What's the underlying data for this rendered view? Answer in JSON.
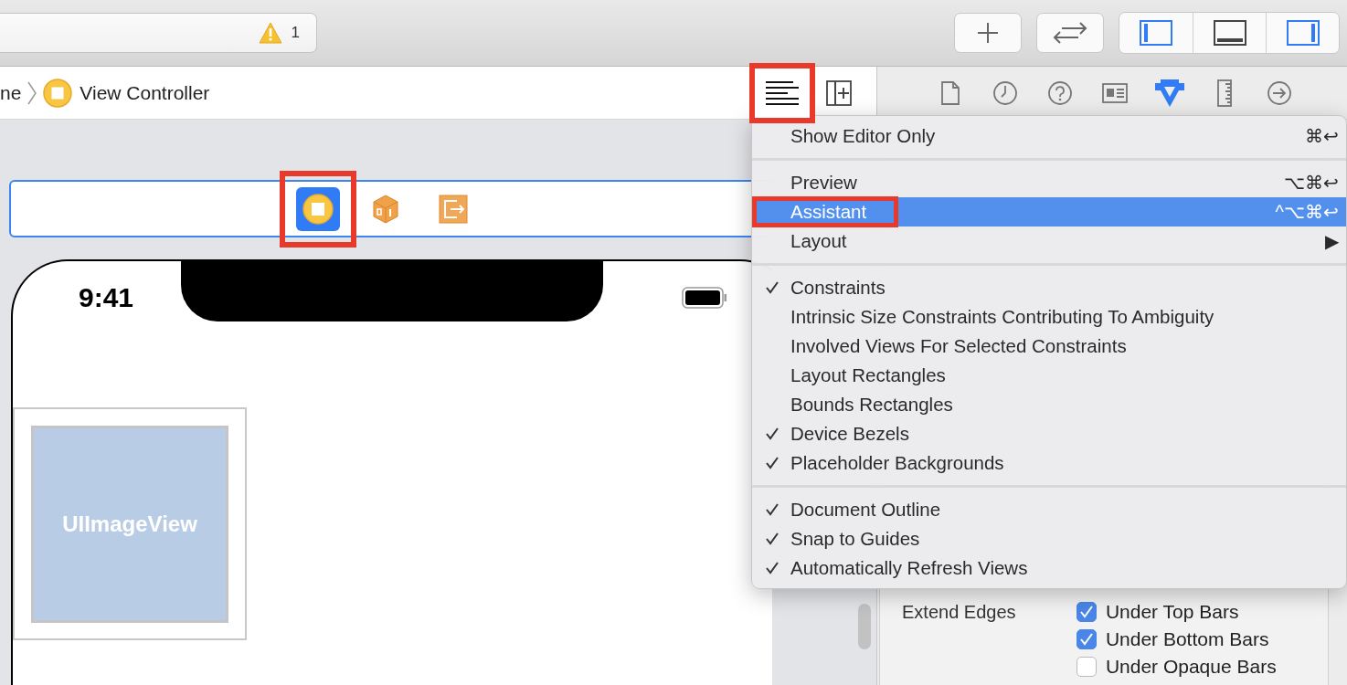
{
  "toolbar": {
    "activity": {
      "warning_count": "1"
    },
    "buttons": [
      {
        "kind": "plus"
      },
      {
        "kind": "swap"
      }
    ],
    "panels": [
      {
        "kind": "left",
        "on": true
      },
      {
        "kind": "bottom",
        "on": false
      },
      {
        "kind": "right",
        "on": true
      }
    ]
  },
  "breadcrumb": {
    "items": [
      "ne",
      "View Controller"
    ]
  },
  "editor_buttons": [
    {
      "kind": "lines",
      "annotated": true
    },
    {
      "kind": "add",
      "annotated": false
    }
  ],
  "inspector_tabs": [
    {
      "kind": "file",
      "selected": false
    },
    {
      "kind": "history",
      "selected": false
    },
    {
      "kind": "help",
      "selected": false
    },
    {
      "kind": "identity",
      "selected": false
    },
    {
      "kind": "attributes",
      "selected": true
    },
    {
      "kind": "size",
      "selected": false
    },
    {
      "kind": "connections",
      "selected": false
    }
  ],
  "scene_dock": [
    {
      "kind": "controller",
      "selected": true,
      "annotated": true
    },
    {
      "kind": "cube",
      "selected": false,
      "annotated": false
    },
    {
      "kind": "exit",
      "selected": false,
      "annotated": false
    }
  ],
  "device": {
    "time": "9:41",
    "image_view": "UIImageView"
  },
  "menu": [
    [
      {
        "label": "Show Editor Only",
        "shortcut": "⌘↩",
        "checked": false,
        "selected": false,
        "annotated": false
      }
    ],
    [
      {
        "label": "Preview",
        "shortcut": "⌥⌘↩",
        "checked": false,
        "selected": false,
        "annotated": false
      },
      {
        "label": "Assistant",
        "shortcut": "^⌥⌘↩",
        "checked": false,
        "selected": true,
        "annotated": true
      },
      {
        "label": "Layout",
        "shortcut": "▶",
        "checked": false,
        "selected": false,
        "annotated": false
      }
    ],
    [
      {
        "label": "Constraints",
        "checked": true,
        "selected": false,
        "annotated": false
      },
      {
        "label": "Intrinsic Size Constraints Contributing To Ambiguity",
        "checked": false,
        "selected": false,
        "annotated": false
      },
      {
        "label": "Involved Views For Selected Constraints",
        "checked": false,
        "selected": false,
        "annotated": false
      },
      {
        "label": "Layout Rectangles",
        "checked": false,
        "selected": false,
        "annotated": false
      },
      {
        "label": "Bounds Rectangles",
        "checked": false,
        "selected": false,
        "annotated": false
      },
      {
        "label": "Device Bezels",
        "checked": true,
        "selected": false,
        "annotated": false
      },
      {
        "label": "Placeholder Backgrounds",
        "checked": true,
        "selected": false,
        "annotated": false
      }
    ],
    [
      {
        "label": "Document Outline",
        "checked": true,
        "selected": false,
        "annotated": false
      },
      {
        "label": "Snap to Guides",
        "checked": true,
        "selected": false,
        "annotated": false
      },
      {
        "label": "Automatically Refresh Views",
        "checked": true,
        "selected": false,
        "annotated": false
      }
    ]
  ],
  "inspector": {
    "extend_edges_label": "Extend Edges",
    "options": [
      {
        "label": "Under Top Bars",
        "checked": true
      },
      {
        "label": "Under Bottom Bars",
        "checked": true
      },
      {
        "label": "Under Opaque Bars",
        "checked": false
      }
    ]
  }
}
